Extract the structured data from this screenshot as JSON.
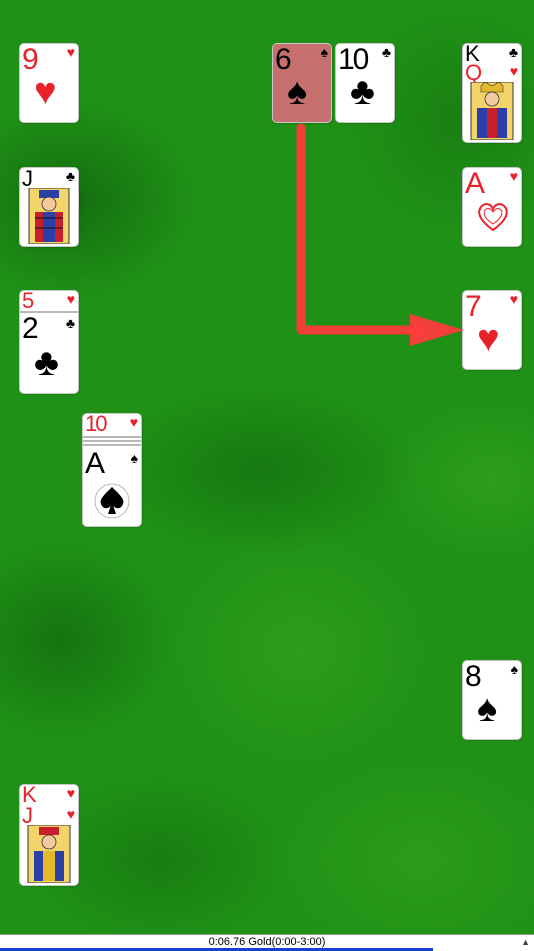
{
  "status": {
    "timer_text": "0:06.76 Gold(0:00-3:00)",
    "progress_fraction": 0.81
  },
  "colors": {
    "felt": "#1f9116",
    "arrow": "#ff3b3b",
    "selected_card": "#c67070",
    "progress": "#1a3fd0"
  },
  "cards": {
    "top_left": {
      "rank": "9",
      "suit": "♥"
    },
    "left_jack": {
      "rank": "J",
      "suit": "♣"
    },
    "left_stack": {
      "under_rank": "5",
      "under_suit": "♥",
      "rank": "2",
      "suit": "♣"
    },
    "mid_stack": {
      "under_rank": "10",
      "under_suit": "♥",
      "rank": "A",
      "suit": "♠"
    },
    "top_selected": {
      "rank": "6",
      "suit": "♠"
    },
    "top_ten": {
      "rank": "10",
      "suit": "♣"
    },
    "right_kq": {
      "under_rank": "K",
      "under_suit": "♣",
      "rank": "Q",
      "suit": "♥"
    },
    "right_ace": {
      "rank": "A",
      "suit": "♥"
    },
    "right_seven": {
      "rank": "7",
      "suit": "♥"
    },
    "right_eight": {
      "rank": "8",
      "suit": "♠"
    },
    "bottom_kj": {
      "under_rank": "K",
      "under_suit": "♥",
      "rank": "J",
      "suit": "♥"
    }
  },
  "icons": {
    "corner": "hat-icon"
  }
}
